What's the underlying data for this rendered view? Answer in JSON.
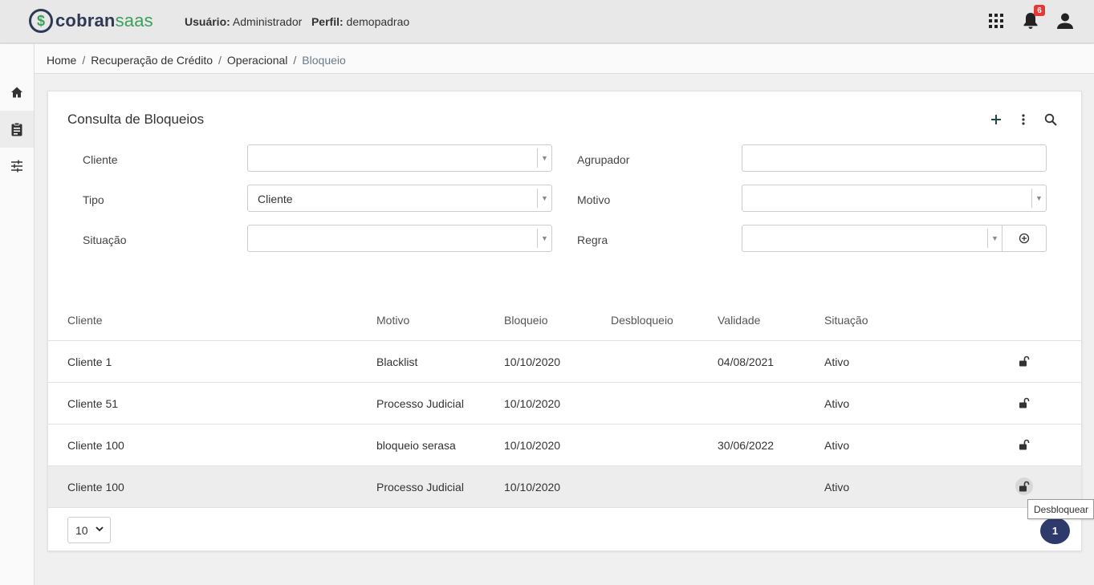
{
  "header": {
    "logo_a": "cobran",
    "logo_b": "saas",
    "user_label": "Usuário:",
    "user_value": "Administrador",
    "profile_label": "Perfil:",
    "profile_value": "demopadrao",
    "notification_count": "6"
  },
  "breadcrumb": {
    "items": [
      "Home",
      "Recuperação de Crédito",
      "Operacional"
    ],
    "separator": "/",
    "current": "Bloqueio"
  },
  "card": {
    "title": "Consulta de Bloqueios"
  },
  "filters": {
    "cliente": {
      "label": "Cliente",
      "value": ""
    },
    "agrupador": {
      "label": "Agrupador",
      "value": ""
    },
    "tipo": {
      "label": "Tipo",
      "value": "Cliente"
    },
    "motivo": {
      "label": "Motivo",
      "value": ""
    },
    "situacao": {
      "label": "Situação",
      "value": ""
    },
    "regra": {
      "label": "Regra",
      "value": ""
    }
  },
  "table": {
    "columns": [
      "Cliente",
      "Motivo",
      "Bloqueio",
      "Desbloqueio",
      "Validade",
      "Situação"
    ],
    "rows": [
      {
        "cliente": "Cliente 1",
        "motivo": "Blacklist",
        "bloqueio": "10/10/2020",
        "desbloqueio": "",
        "validade": "04/08/2021",
        "situacao": "Ativo"
      },
      {
        "cliente": "Cliente 51",
        "motivo": "Processo Judicial",
        "bloqueio": "10/10/2020",
        "desbloqueio": "",
        "validade": "",
        "situacao": "Ativo"
      },
      {
        "cliente": "Cliente 100",
        "motivo": "bloqueio serasa",
        "bloqueio": "10/10/2020",
        "desbloqueio": "",
        "validade": "30/06/2022",
        "situacao": "Ativo"
      },
      {
        "cliente": "Cliente 100",
        "motivo": "Processo Judicial",
        "bloqueio": "10/10/2020",
        "desbloqueio": "",
        "validade": "",
        "situacao": "Ativo"
      }
    ]
  },
  "pagination": {
    "page_size": "10",
    "current_page": "1"
  },
  "tooltip": "Desbloquear",
  "colors": {
    "accent": "#2e3a6b",
    "brand_green": "#3aa05a",
    "badge": "#e53935"
  }
}
